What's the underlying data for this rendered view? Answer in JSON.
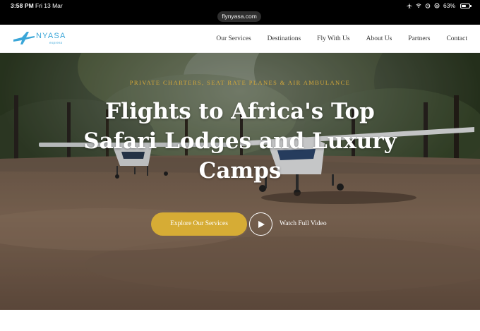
{
  "status_bar": {
    "time": "3:58 PM",
    "date": "Fri 13 Mar",
    "battery_percent": "63%",
    "battery_level": 0.63,
    "icons": [
      "airplane-mode-icon",
      "wifi-icon",
      "alarm-icon",
      "lock-rotation-icon"
    ]
  },
  "browser": {
    "url": "flynyasa.com"
  },
  "site": {
    "logo_name": "NYASA",
    "logo_sub": "express",
    "brand_color": "#3aa6d8",
    "nav": [
      {
        "label": "Our Services"
      },
      {
        "label": "Destinations"
      },
      {
        "label": "Fly With Us"
      },
      {
        "label": "About Us"
      },
      {
        "label": "Partners"
      },
      {
        "label": "Contact"
      }
    ]
  },
  "hero": {
    "eyebrow": "PRIVATE CHARTERS, SEAT RATE PLANES & AIR AMBULANCE",
    "headline_lines": [
      "Flights to Africa's Top",
      "Safari Lodges and Luxury",
      "Camps"
    ],
    "primary_cta": "Explore Our Services",
    "video_link": "Watch Full Video",
    "accent_color": "#d6ac35",
    "play_icon": "play-icon"
  }
}
